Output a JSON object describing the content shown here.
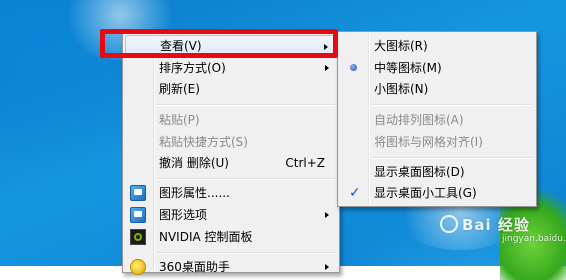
{
  "context_menu": {
    "items": [
      {
        "label": "查看(V)",
        "has_submenu": true
      },
      {
        "label": "排序方式(O)",
        "has_submenu": true
      },
      {
        "label": "刷新(E)"
      },
      {
        "label": "粘贴(P)",
        "disabled": true
      },
      {
        "label": "粘贴快捷方式(S)",
        "disabled": true
      },
      {
        "label": "撤消 删除(U)",
        "shortcut": "Ctrl+Z"
      },
      {
        "label": "图形属性......",
        "icon": "graphics-properties-icon"
      },
      {
        "label": "图形选项",
        "icon": "graphics-options-icon",
        "has_submenu": true
      },
      {
        "label": "NVIDIA 控制面板",
        "icon": "nvidia-icon"
      },
      {
        "label": "360桌面助手",
        "icon": "360-icon",
        "has_submenu": true
      }
    ]
  },
  "view_submenu": {
    "items": [
      {
        "label": "大图标(R)"
      },
      {
        "label": "中等图标(M)",
        "selected": true
      },
      {
        "label": "小图标(N)"
      },
      {
        "label": "自动排列图标(A)",
        "disabled": true
      },
      {
        "label": "将图标与网格对齐(I)",
        "disabled": true
      },
      {
        "label": "显示桌面图标(D)"
      },
      {
        "label": "显示桌面小工具(G)",
        "checked": true
      }
    ]
  },
  "colors": {
    "highlight_box": "#e80a10",
    "desktop_blue": "#1597e0",
    "menu_bg": "#f0f0f0"
  },
  "watermark": {
    "text": "Bai 经验",
    "sub": "jingyan.baidu.com"
  }
}
